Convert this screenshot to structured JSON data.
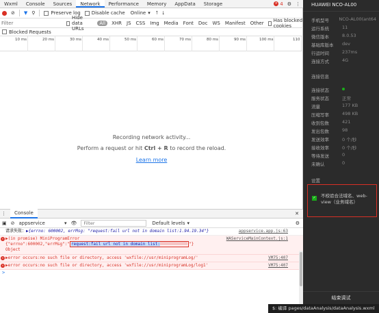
{
  "tabs": [
    "Wxml",
    "Console",
    "Sources",
    "Network",
    "Performance",
    "Memory",
    "AppData",
    "Storage"
  ],
  "active_tab": "Network",
  "error_count": "4",
  "network_toolbar": {
    "preserve_log": "Preserve log",
    "disable_cache": "Disable cache",
    "throttle": "Online"
  },
  "filter": {
    "placeholder": "Filter",
    "hide_data_urls": "Hide data URLs",
    "types": [
      "All",
      "XHR",
      "JS",
      "CSS",
      "Img",
      "Media",
      "Font",
      "Doc",
      "WS",
      "Manifest",
      "Other"
    ],
    "has_blocked_cookies": "Has blocked cookies"
  },
  "blocked_requests": "Blocked Requests",
  "timeline_ticks": [
    "10 ms",
    "20 ms",
    "30 ms",
    "40 ms",
    "50 ms",
    "60 ms",
    "70 ms",
    "80 ms",
    "90 ms",
    "100 ms",
    "110"
  ],
  "empty_state": {
    "title": "Recording network activity...",
    "sub_prefix": "Perform a request or hit ",
    "sub_keys": "Ctrl + R",
    "sub_suffix": " to record the reload.",
    "link": "Learn more"
  },
  "console": {
    "tab": "Console",
    "context": "appservice",
    "filter_placeholder": "Filter",
    "levels": "Default levels",
    "logs": [
      {
        "type": "info",
        "text_a": "请求失败：",
        "text_b": "▶{errno: 600002, errMsg: \"request:fail url not in domain list:1.94.19.34\"}",
        "src": "appservice.app.js:63"
      },
      {
        "type": "error",
        "line1": "▶(in promise) MiniProgramError",
        "line2_a": "{\"errno\":600002,\"errMsg\":\"",
        "line2_hl": "request:fail url not in domain list:",
        "line2_b": "\"}",
        "line3": "Object",
        "src": "WAServiceMainContext.js:1"
      },
      {
        "type": "error",
        "text": "▶error occurs:no such file or directory, access 'wxfile://usr/miniprogramLog/'",
        "src": "VM75:407"
      },
      {
        "type": "error",
        "text": "▶error occurs:no such file or directory, access 'wxfile://usr/miniprogramLog/log1'",
        "src": "VM75:407"
      }
    ],
    "prompt": ">"
  },
  "panel": {
    "device": "HUAWEI NCO-AL00",
    "info": [
      {
        "k": "手机型号",
        "v": "NCO-AL00(ant64..."
      },
      {
        "k": "运行系统",
        "v": "11"
      },
      {
        "k": "微信版本",
        "v": "8.0.53"
      },
      {
        "k": "基础库版本",
        "v": "dev"
      },
      {
        "k": "行运时间",
        "v": "237ms"
      },
      {
        "k": "连接方式",
        "v": "4G"
      }
    ],
    "conn_section": "连接信息",
    "conn": [
      {
        "k": "连接状态",
        "v": ""
      },
      {
        "k": "服务状态",
        "v": "正常"
      },
      {
        "k": "流量",
        "v": "177 KB"
      },
      {
        "k": "压缩写率",
        "v": "498 KB"
      },
      {
        "k": "收到包数",
        "v": "421"
      },
      {
        "k": "发出包数",
        "v": "98"
      },
      {
        "k": "发送效率",
        "v": "0 个/秒"
      },
      {
        "k": "接收效率",
        "v": "0 个/秒"
      },
      {
        "k": "等待发送",
        "v": "0"
      },
      {
        "k": "未确认",
        "v": "0"
      }
    ],
    "settings_section": "设置",
    "settings_label": "不校验合法域名、web-view（业务域名）",
    "remote_debug": "结束调试"
  },
  "statusbar": "$: 编译 pages/dataAnalysis/dataAnalysis.wxml"
}
